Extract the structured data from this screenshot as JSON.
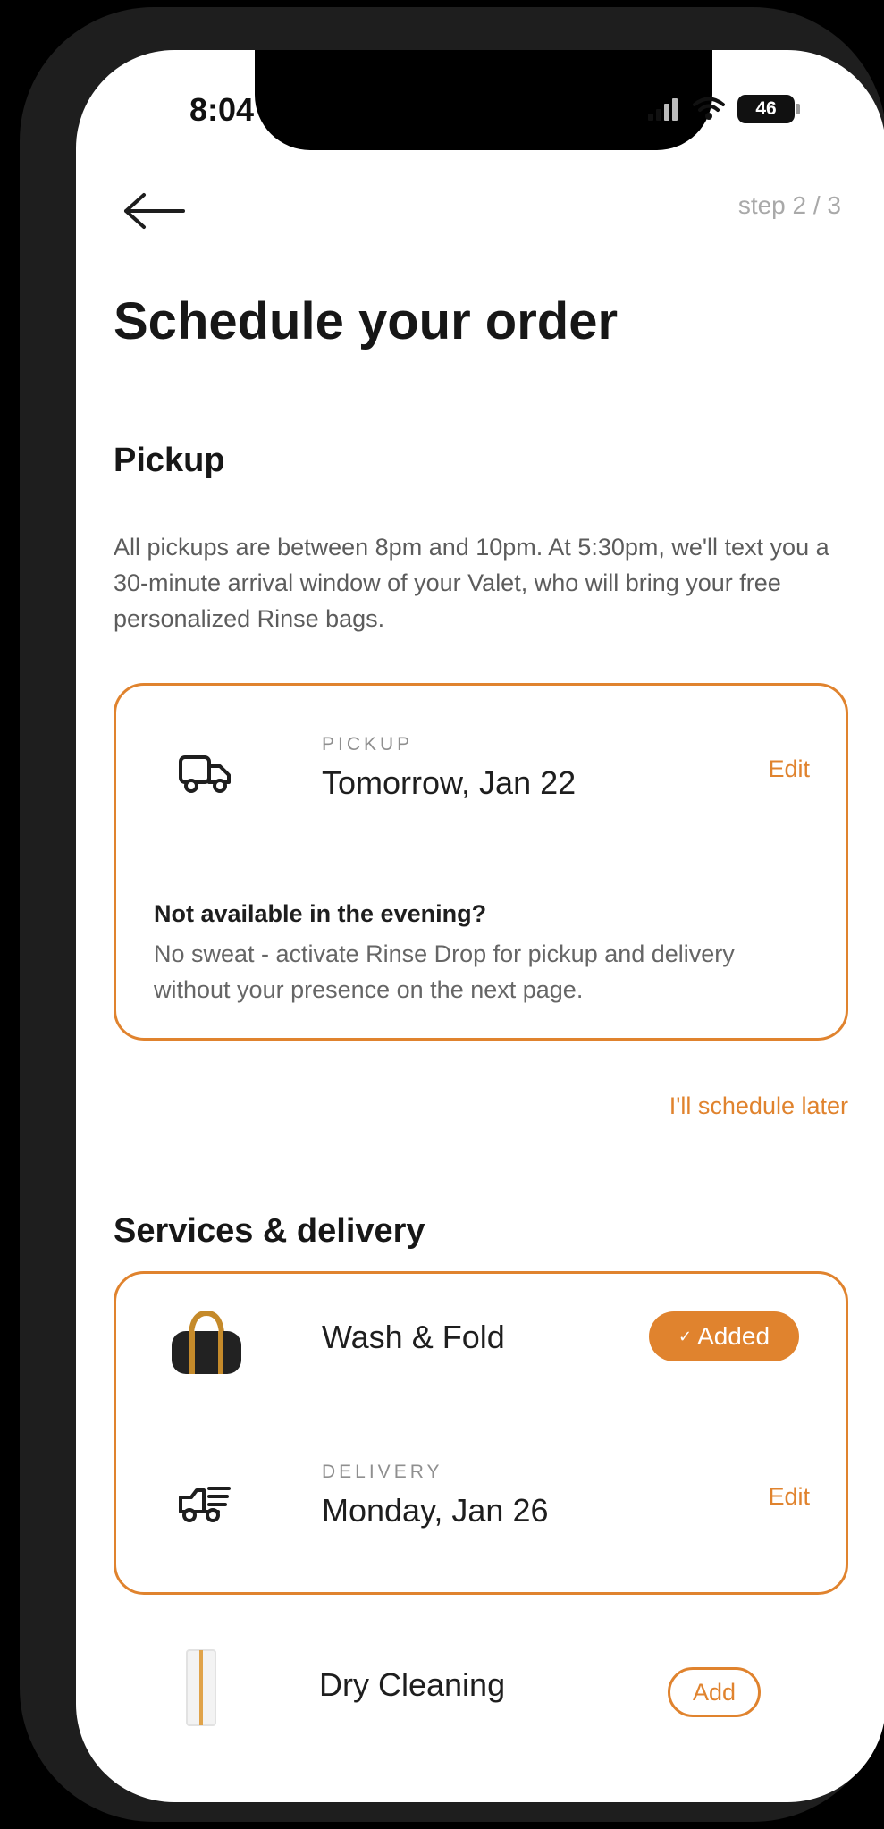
{
  "status_bar": {
    "time": "8:04",
    "battery": "46"
  },
  "header": {
    "step": "step 2 / 3"
  },
  "page": {
    "title": "Schedule your order"
  },
  "pickup": {
    "heading": "Pickup",
    "info": "All pickups are between 8pm and 10pm. At 5:30pm, we'll text you a 30-minute arrival window of your Valet, who will bring your free personalized Rinse bags.",
    "card": {
      "label": "PICKUP",
      "date": "Tomorrow, Jan 22",
      "edit": "Edit",
      "note_title": "Not available in the evening?",
      "note_body": "No sweat - activate Rinse Drop for pickup and delivery without your presence on the next page."
    },
    "schedule_later": "I'll schedule later"
  },
  "services": {
    "heading": "Services & delivery",
    "wash_fold": {
      "name": "Wash & Fold",
      "status": "Added",
      "check": "✓"
    },
    "delivery": {
      "label": "DELIVERY",
      "date": "Monday, Jan 26",
      "edit": "Edit"
    },
    "dry_cleaning": {
      "name": "Dry Cleaning",
      "action": "Add"
    }
  },
  "colors": {
    "accent": "#e0832e",
    "text": "#171717",
    "muted": "#5c5c5c"
  },
  "icons": {
    "back": "arrow-left-icon",
    "pickup": "pickup-truck-icon",
    "delivery": "delivery-truck-icon",
    "wash_fold": "duffel-bag-icon",
    "dry_cleaning": "garment-bag-icon"
  }
}
